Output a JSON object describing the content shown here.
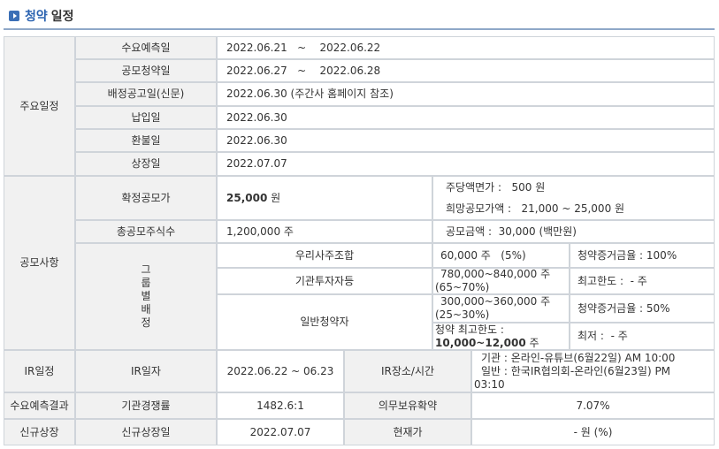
{
  "section_title": {
    "part1": "청약",
    "part2": "일정"
  },
  "main_schedule": {
    "label": "주요일정",
    "rows": [
      {
        "label": "수요예측일",
        "value": "2022.06.21   ~    2022.06.22"
      },
      {
        "label": "공모청약일",
        "value": "2022.06.27   ~    2022.06.28"
      },
      {
        "label": "배정공고일(신문)",
        "value": "2022.06.30 (주간사 홈페이지 참조)"
      },
      {
        "label": "납입일",
        "value": "2022.06.30"
      },
      {
        "label": "환불일",
        "value": "2022.06.30"
      },
      {
        "label": "상장일",
        "value": "2022.07.07"
      }
    ]
  },
  "offering": {
    "label": "공모사항",
    "fixed_price_label": "확정공모가",
    "fixed_price_value": "25,000",
    "fixed_price_unit": " 원",
    "par_value": "주당액면가 :   500 원",
    "hope_price": "희망공모가액 :   21,000 ~ 25,000 원",
    "total_shares_label": "총공모주식수",
    "total_shares_value": "1,200,000 주",
    "amount": "공모금액 :  30,000 (백만원)",
    "group_label": [
      "그",
      "룹",
      "별",
      "배",
      "정"
    ],
    "employee_label": "우리사주조합",
    "employee_shares": "60,000 주   (5%)",
    "employee_margin": "청약증거금율 : 100%",
    "institution_label": "기관투자자등",
    "institution_shares_1": "780,000~840,000 주",
    "institution_shares_2": "(65~70%)",
    "institution_limit": "최고한도 :  - 주",
    "general_label": "일반청약자",
    "general_shares_1": "300,000~360,000 주",
    "general_shares_2": "(25~30%)",
    "general_margin": "청약증거금율 : 50%",
    "general_max_1": "청약 최고한도 :",
    "general_max_2": "10,000~12,000",
    "general_max_unit": " 주",
    "general_min": "최저 :  - 주"
  },
  "ir": {
    "label": "IR일정",
    "date_label": "IR일자",
    "date_value": "2022.06.22 ~ 06.23",
    "place_label": "IR장소/시간",
    "place_line1": "기관 : 온라인-유튜브(6월22일) AM 10:00",
    "place_line2": "일반 : 한국IR협의회-온라인(6월23일) PM",
    "place_line3": "03:10"
  },
  "forecast": {
    "label": "수요예측결과",
    "competition_label": "기관경쟁률",
    "competition_value": "1482.6:1",
    "lockup_label": "의무보유확약",
    "lockup_value": "7.07%"
  },
  "listing": {
    "label": "신규상장",
    "date_label": "신규상장일",
    "date_value": "2022.07.07",
    "price_label": "현재가",
    "price_value": "- 원 (%)"
  }
}
